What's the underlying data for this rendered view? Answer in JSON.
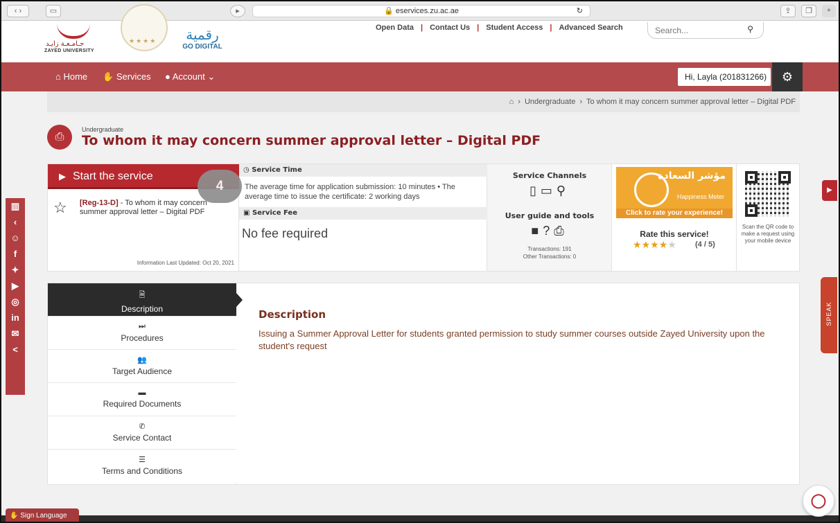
{
  "browser": {
    "url": "eservices.zu.ac.ae"
  },
  "header": {
    "zu_arabic": "جـامـعـة زايـد",
    "zu_english": "ZAYED UNIVERSITY",
    "digital_arabic": "رقمية",
    "digital_english": "GO DIGITAL",
    "links": [
      "Open Data",
      "Contact Us",
      "Student Access",
      "Advanced Search"
    ],
    "search_placeholder": "Search..."
  },
  "nav": {
    "home": "Home",
    "services": "Services",
    "account": "Account",
    "user": "Hi, Layla (201831266)"
  },
  "breadcrumb": {
    "items": [
      "Undergraduate",
      "To whom it may concern summer approval letter – Digital PDF"
    ]
  },
  "page": {
    "category": "Undergraduate",
    "title": "To whom it may concern summer approval letter – Digital PDF"
  },
  "service": {
    "start_label": "Start the service",
    "step_badge": "4",
    "code": "[Reg-13-D]",
    "name": "- To whom it may concern summer approval letter – Digital PDF",
    "last_updated": "Information Last Updated: Oct 20, 2021",
    "time_heading": "Service Time",
    "time_text": "The average time for application submission: 10 minutes • The average time to issue the certificate: 2 working days",
    "fee_heading": "Service Fee",
    "fee_text": "No fee required"
  },
  "channels": {
    "title": "Service Channels",
    "guide_title": "User guide and tools",
    "transactions": "Transactions: 191",
    "other_transactions": "Other Transactions: 0"
  },
  "rating": {
    "happiness_arabic": "مؤشر السعادة",
    "happiness_english": "Happiness Meter",
    "click_text": "Click to rate your experience!",
    "title": "Rate this service!",
    "score": "(4 / 5)",
    "stars": 4,
    "max_stars": 5
  },
  "qr": {
    "text": "Scan the QR code to make a request using your mobile device"
  },
  "tabs": [
    {
      "label": "Description",
      "icon": "file-icon",
      "glyph": "🗎"
    },
    {
      "label": "Procedures",
      "icon": "step-icon",
      "glyph": "⏭"
    },
    {
      "label": "Target Audience",
      "icon": "users-icon",
      "glyph": "👥"
    },
    {
      "label": "Required Documents",
      "icon": "folder-icon",
      "glyph": "▬"
    },
    {
      "label": "Service Contact",
      "icon": "phone-icon",
      "glyph": "✆"
    },
    {
      "label": "Terms and Conditions",
      "icon": "list-icon",
      "glyph": "☰"
    }
  ],
  "description": {
    "title": "Description",
    "body": "Issuing a Summer Approval Letter for students granted permission to study summer courses outside Zayed University upon the student's request"
  },
  "floating": {
    "speak": "SPEAK",
    "sign_language": "Sign Language"
  }
}
